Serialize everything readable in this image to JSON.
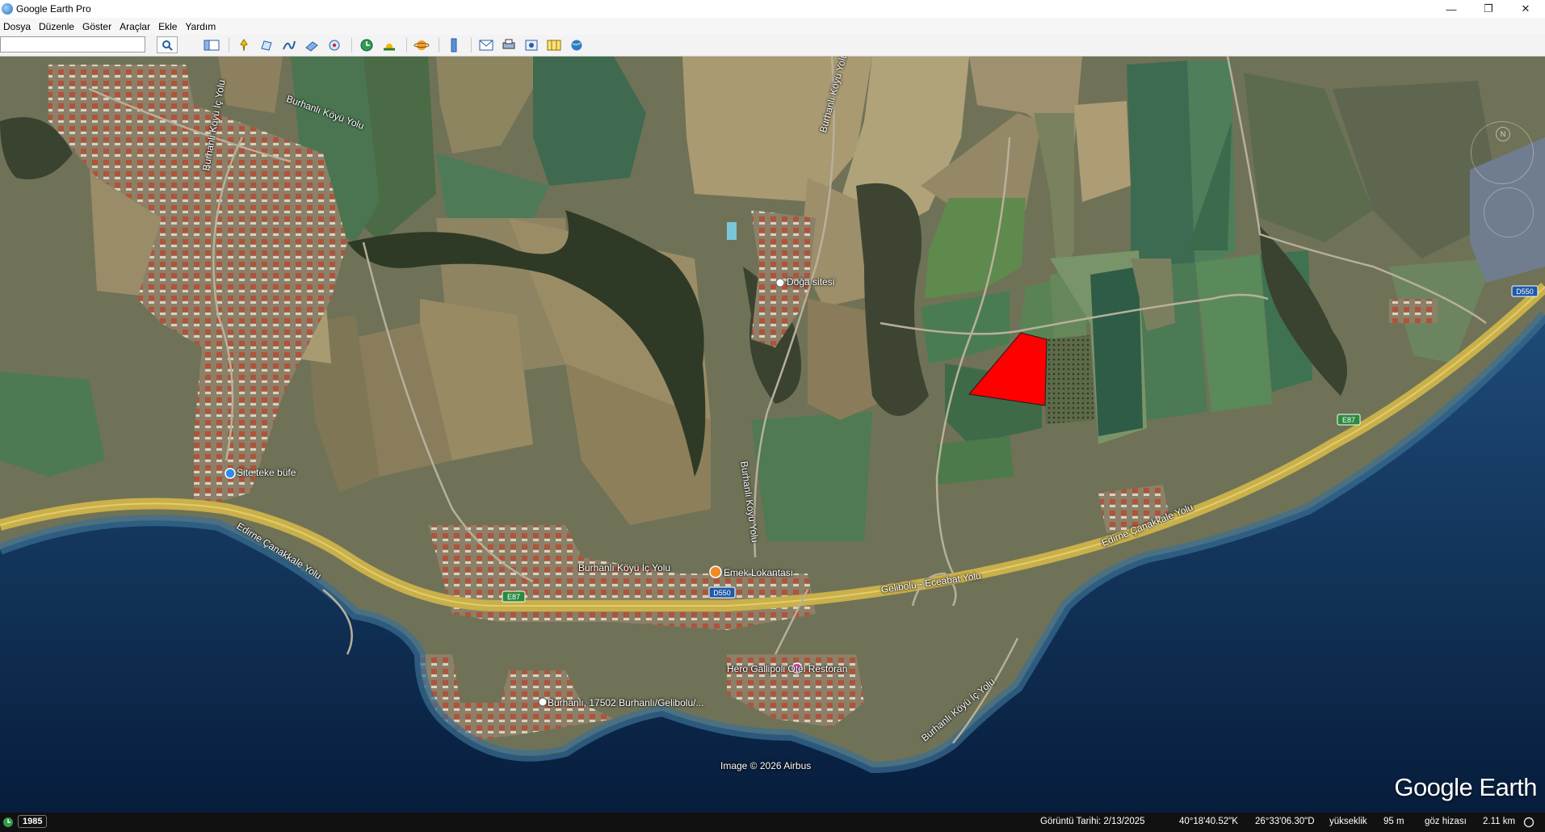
{
  "window": {
    "title": "Google Earth Pro",
    "minimize": "—",
    "maximize": "❐",
    "close": "✕"
  },
  "menu": [
    "Dosya",
    "Düzenle",
    "Göster",
    "Araçlar",
    "Ekle",
    "Yardım"
  ],
  "search": {
    "value": "",
    "placeholder": ""
  },
  "map": {
    "labels": {
      "burhanli_koyu_yolu_top": "Burhanlı Köyü Yolu",
      "burhanli_koyu_ic_yolu_left": "Burhanlı Köyü İç Yolu",
      "doga_sitesi": "Doğa sitesi",
      "site_teke_bufe": "Site teke büfe",
      "burhanli_koyu_ic_yolu_center": "Burhanlı Köyü İç Yolu",
      "emek_lokantasi": "Emek Lokantası",
      "burhanli_koyu_yolu_center": "Burhanlı Köyü Yolu",
      "edirne_canakkale_left": "Edirne Çanakkale Yolu",
      "edirne_canakkale_right": "Edirne Çanakkale Yolu",
      "gelibolu_eceabat": "Gelibolu - Eceabat Yolu",
      "hero_gallipoli": "Hero Gallipoli Otel Restoran",
      "burhanli_address": "Burhanlı, 17502 Burhanlı/Gelibolu/...",
      "burhanli_koyu_ic_yolu_bottom": "Burhanlı Köyü İç Yolu",
      "image_credit": "Image © 2026 Airbus"
    },
    "road_shields": {
      "e87_left": "E87",
      "d550_center": "D550",
      "e87_right": "E87",
      "d550_right": "D550"
    },
    "logo": "Google Earth",
    "highlight_color": "#ff0000"
  },
  "status": {
    "year": "1985",
    "date": "Görüntü Tarihi: 2/13/2025",
    "lat": "40°18'40.52\"K",
    "lon": "26°33'06.30\"D",
    "elev_label": "yükseklik",
    "elev_value": "95 m",
    "eye_label": "göz hizası",
    "eye_value": "2.11 km"
  }
}
